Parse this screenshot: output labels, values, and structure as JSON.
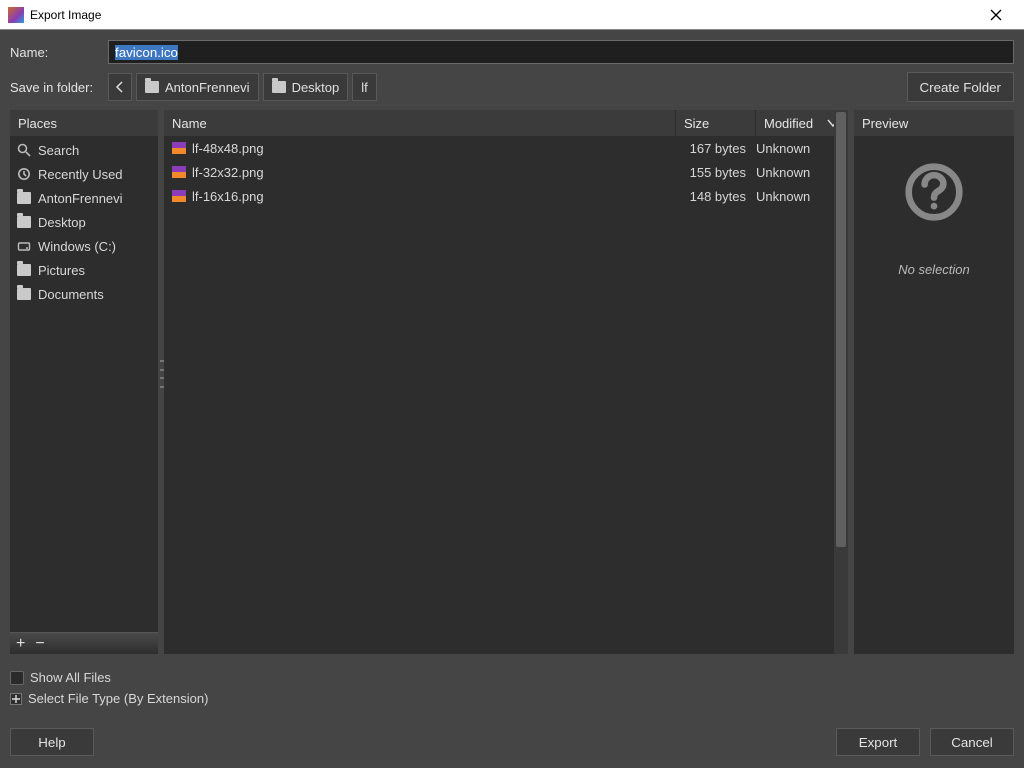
{
  "window": {
    "title": "Export Image"
  },
  "name_row": {
    "label": "Name:",
    "value": "favicon.ico"
  },
  "folder_row": {
    "label": "Save in folder:",
    "crumbs": [
      {
        "label": "AntonFrennevi"
      },
      {
        "label": "Desktop"
      },
      {
        "label": "lf"
      }
    ],
    "create_folder": "Create Folder"
  },
  "places": {
    "header": "Places",
    "items": [
      {
        "icon": "search",
        "label": "Search"
      },
      {
        "icon": "recent",
        "label": "Recently Used"
      },
      {
        "icon": "folder",
        "label": "AntonFrennevi"
      },
      {
        "icon": "folder",
        "label": "Desktop"
      },
      {
        "icon": "drive",
        "label": "Windows (C:)"
      },
      {
        "icon": "folder",
        "label": "Pictures"
      },
      {
        "icon": "folder",
        "label": "Documents"
      }
    ]
  },
  "files": {
    "headers": {
      "name": "Name",
      "size": "Size",
      "modified": "Modified"
    },
    "rows": [
      {
        "name": "lf-48x48.png",
        "size": "167 bytes",
        "modified": "Unknown"
      },
      {
        "name": "lf-32x32.png",
        "size": "155 bytes",
        "modified": "Unknown"
      },
      {
        "name": "lf-16x16.png",
        "size": "148 bytes",
        "modified": "Unknown"
      }
    ]
  },
  "preview": {
    "header": "Preview",
    "empty": "No selection"
  },
  "options": {
    "show_all": "Show All Files",
    "select_type": "Select File Type (By Extension)"
  },
  "buttons": {
    "help": "Help",
    "export": "Export",
    "cancel": "Cancel"
  }
}
